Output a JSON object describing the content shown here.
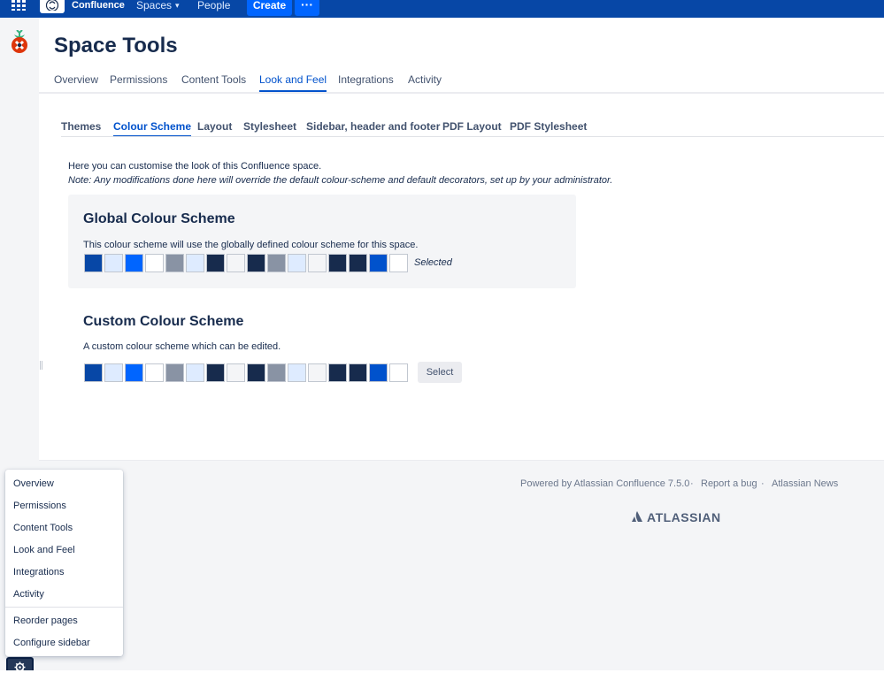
{
  "topbar": {
    "app_name": "Confluence",
    "spaces_label": "Spaces",
    "people_label": "People",
    "create_label": "Create",
    "more_label": "···"
  },
  "page": {
    "title": "Space Tools"
  },
  "tabs": [
    {
      "label": "Overview"
    },
    {
      "label": "Permissions"
    },
    {
      "label": "Content Tools"
    },
    {
      "label": "Look and Feel",
      "active": true
    },
    {
      "label": "Integrations"
    },
    {
      "label": "Activity"
    }
  ],
  "subtabs": [
    {
      "label": "Themes"
    },
    {
      "label": "Colour Scheme",
      "active": true
    },
    {
      "label": "Layout"
    },
    {
      "label": "Stylesheet"
    },
    {
      "label": "Sidebar, header and footer"
    },
    {
      "label": "PDF Layout"
    },
    {
      "label": "PDF Stylesheet"
    }
  ],
  "intro": {
    "line1": "Here you can customise the look of this Confluence space.",
    "line2": "Note: Any modifications done here will override the default colour-scheme and default decorators, set up by your administrator."
  },
  "global_scheme": {
    "title": "Global Colour Scheme",
    "description": "This colour scheme will use the globally defined colour scheme for this space.",
    "status": "Selected"
  },
  "custom_scheme": {
    "title": "Custom Colour Scheme",
    "description": "A custom colour scheme which can be edited.",
    "select_label": "Select"
  },
  "swatch_colors": [
    "#0747a6",
    "#deebff",
    "#0065ff",
    "#ffffff",
    "#8993a4",
    "#deebff",
    "#172b4d",
    "#f4f5f7",
    "#172b4d",
    "#8993a4",
    "#deebff",
    "#f4f5f7",
    "#172b4d",
    "#172b4d",
    "#0052cc",
    "#ffffff"
  ],
  "footer": {
    "powered": "Powered by Atlassian Confluence 7.5.0",
    "sep": "·",
    "report_bug": "Report a bug",
    "news": "Atlassian News",
    "brand": "ATLASSIAN"
  },
  "sidebar_menu": {
    "items": [
      "Overview",
      "Permissions",
      "Content Tools",
      "Look and Feel",
      "Integrations",
      "Activity"
    ],
    "reorder": "Reorder pages",
    "configure": "Configure sidebar"
  },
  "colors": {
    "nav_bg": "#0747a6",
    "primary": "#0052cc",
    "create_btn": "#0065ff"
  }
}
